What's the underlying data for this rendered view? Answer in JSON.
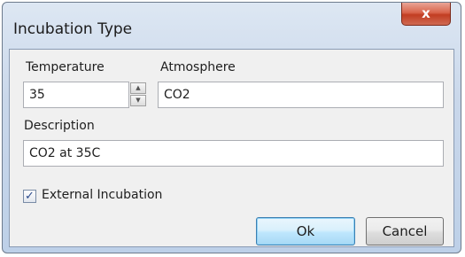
{
  "window": {
    "title": "Incubation Type",
    "close_glyph": "x"
  },
  "form": {
    "temperature": {
      "label": "Temperature",
      "value": "35"
    },
    "atmosphere": {
      "label": "Atmosphere",
      "value": "CO2"
    },
    "description": {
      "label": "Description",
      "value": "CO2 at 35C"
    },
    "external_incubation": {
      "label": "External Incubation",
      "checked": true
    }
  },
  "buttons": {
    "ok": "Ok",
    "cancel": "Cancel"
  },
  "icons": {
    "close": "close-icon",
    "spin_up": "arrow-up-icon",
    "spin_down": "arrow-down-icon",
    "check": "checkmark-icon"
  }
}
